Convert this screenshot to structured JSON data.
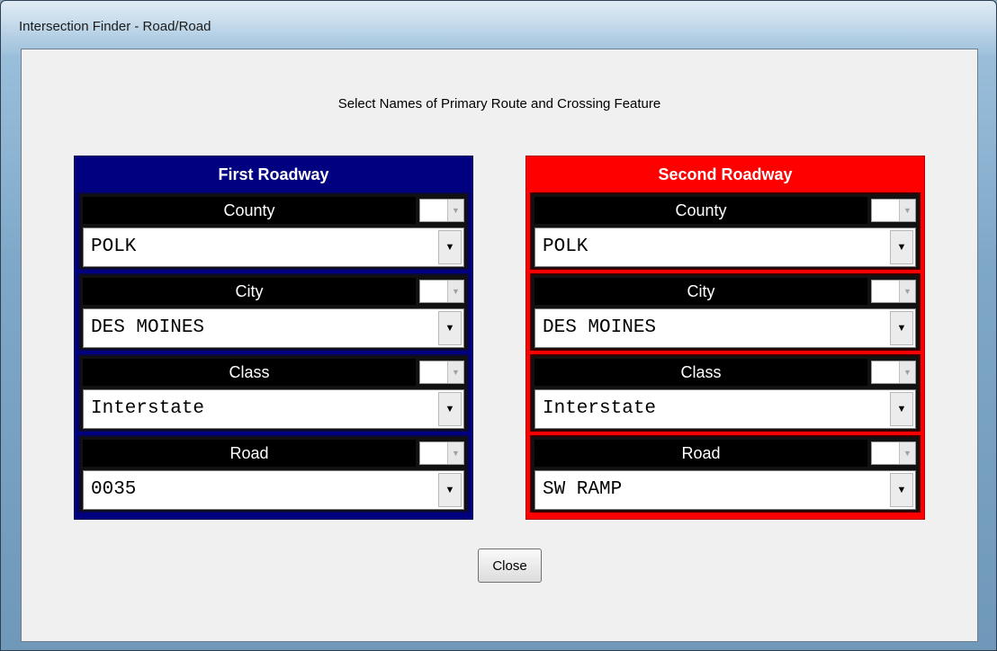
{
  "window": {
    "title": "Intersection Finder - Road/Road"
  },
  "instruction": "Select Names of Primary Route and Crossing Feature",
  "colors": {
    "first_panel": "#000080",
    "second_panel": "#ff0000"
  },
  "first": {
    "header": "First Roadway",
    "county": {
      "label": "County",
      "value": "POLK"
    },
    "city": {
      "label": "City",
      "value": "DES MOINES"
    },
    "class": {
      "label": "Class",
      "value": "Interstate"
    },
    "road": {
      "label": "Road",
      "value": "0035"
    }
  },
  "second": {
    "header": "Second Roadway",
    "county": {
      "label": "County",
      "value": "POLK"
    },
    "city": {
      "label": "City",
      "value": "DES MOINES"
    },
    "class": {
      "label": "Class",
      "value": "Interstate"
    },
    "road": {
      "label": "Road",
      "value": "SW RAMP"
    }
  },
  "close_label": "Close"
}
